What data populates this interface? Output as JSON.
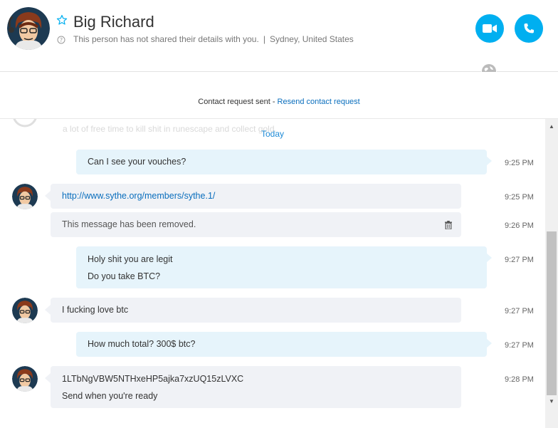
{
  "header": {
    "name": "Big Richard",
    "details": "This person has not shared their details with you.",
    "location": "Sydney, United States",
    "separator": "|"
  },
  "banner": {
    "text": "Contact request sent - ",
    "link": "Resend contact request"
  },
  "chat": {
    "ghost_text": "a lot of free time to kill shit in runescape and collect gold.",
    "day_label": "Today",
    "messages": [
      {
        "lines": [
          "Can I see your vouches?"
        ],
        "time": "9:25 PM"
      },
      {
        "lines": [
          "http://www.sythe.org/members/sythe.1/"
        ],
        "time": "9:25 PM"
      },
      {
        "lines": [
          "This message has been removed."
        ],
        "time": "9:26 PM"
      },
      {
        "lines": [
          "Holy shit you are legit",
          "Do you take BTC?"
        ],
        "time": "9:27 PM"
      },
      {
        "lines": [
          "I fucking love btc"
        ],
        "time": "9:27 PM"
      },
      {
        "lines": [
          "How much total? 300$ btc?"
        ],
        "time": "9:27 PM"
      },
      {
        "lines": [
          "1LTbNgVBW5NTHxeHP5ajka7xzUQ15zLVXC",
          "Send when you're ready"
        ],
        "time": "9:28 PM"
      }
    ]
  },
  "icons": {
    "star": "star-outline-icon",
    "info": "info-circle-icon",
    "video": "video-camera-icon",
    "call": "phone-icon",
    "globe": "globe-icon",
    "trash": "trash-icon"
  },
  "colors": {
    "accent": "#00aff0",
    "link": "#0a6ebd",
    "outgoing_bubble": "#e6f4fb",
    "incoming_bubble": "#f0f2f6"
  }
}
